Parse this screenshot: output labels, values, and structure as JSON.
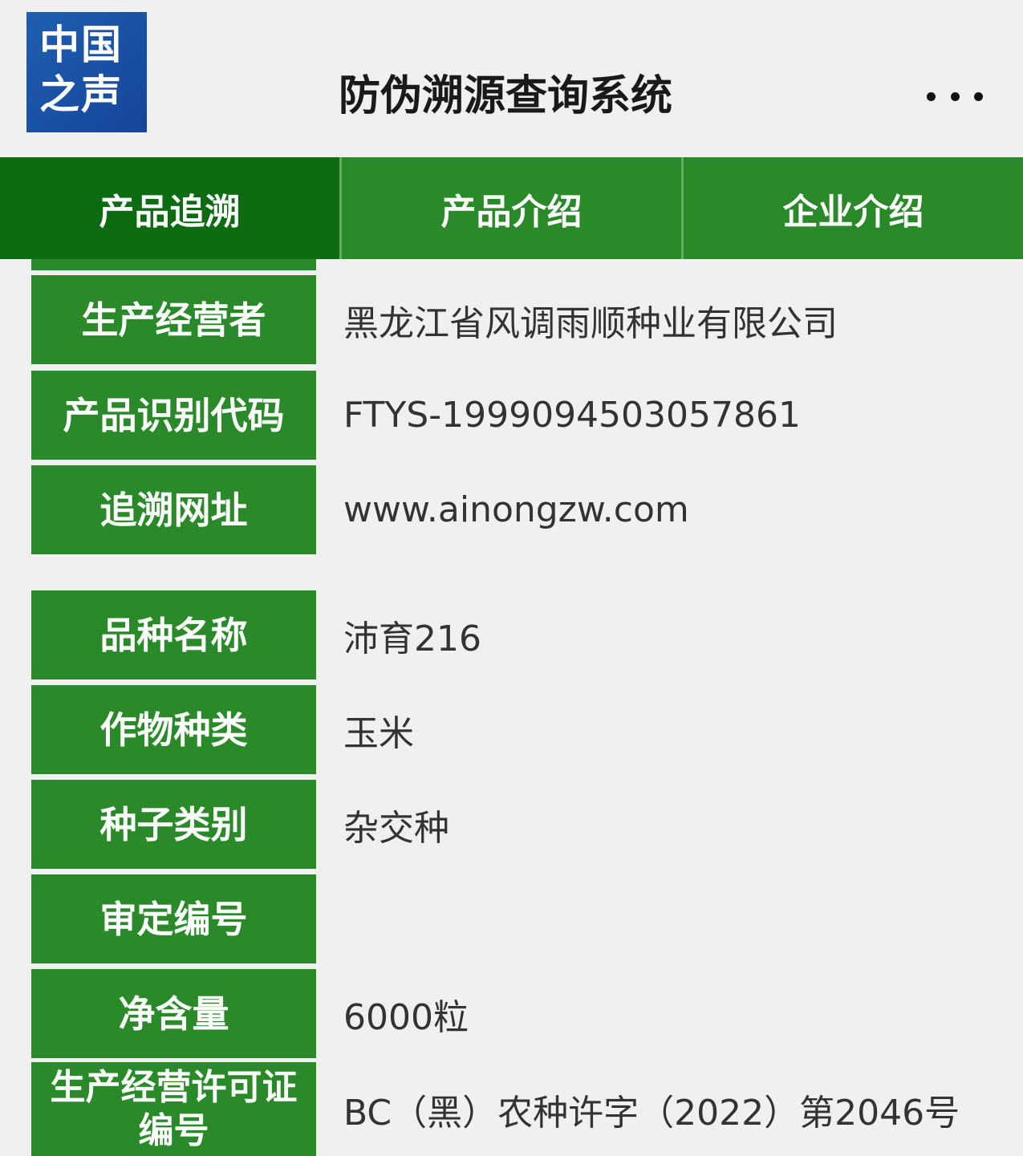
{
  "header": {
    "logo_line1": "中国",
    "logo_line2": "之声",
    "title": "防伪溯源查询系统",
    "more_icon": "more-horizontal-icon"
  },
  "tabs": [
    {
      "label": "产品追溯",
      "active": true
    },
    {
      "label": "产品介绍",
      "active": false
    },
    {
      "label": "企业介绍",
      "active": false
    }
  ],
  "rows": [
    {
      "label": "生产经营者",
      "value": "黑龙江省风调雨顺种业有限公司"
    },
    {
      "label": "产品识别代码",
      "value": "FTYS-1999094503057861"
    },
    {
      "label": "追溯网址",
      "value": "www.ainongzw.com"
    },
    {
      "label": "品种名称",
      "value": "沛育216"
    },
    {
      "label": "作物种类",
      "value": "玉米"
    },
    {
      "label": "种子类别",
      "value": "杂交种"
    },
    {
      "label": "审定编号",
      "value": ""
    },
    {
      "label": "净含量",
      "value": "6000粒"
    },
    {
      "label": "生产经营许可证编号",
      "value": "BC（黑）农种许字（2022）第2046号"
    }
  ],
  "colors": {
    "tab_green": "#2a8a2a",
    "tab_active_green": "#0d6b12",
    "label_green": "#2a8a2a",
    "background": "#f0f0f0",
    "logo_blue": "#1f5fb0"
  }
}
